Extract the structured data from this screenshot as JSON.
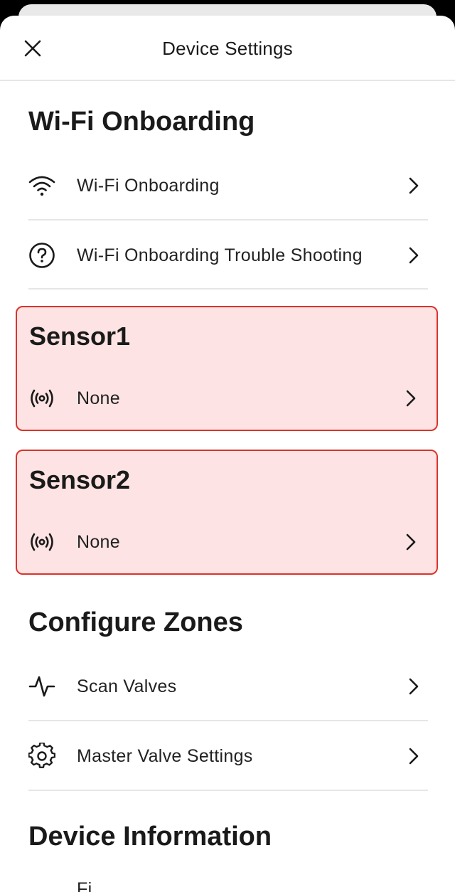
{
  "header": {
    "title": "Device Settings"
  },
  "sections": {
    "wifi": {
      "title": "Wi-Fi Onboarding",
      "items": [
        {
          "label": "Wi-Fi Onboarding",
          "icon": "wifi-icon"
        },
        {
          "label": "Wi-Fi Onboarding Trouble Shooting",
          "icon": "help-circle-icon"
        }
      ]
    },
    "sensor1": {
      "title": "Sensor1",
      "value": "None",
      "icon": "sensor-broadcast-icon",
      "highlight_color": "#fde3e3",
      "border_color": "#d9342b"
    },
    "sensor2": {
      "title": "Sensor2",
      "value": "None",
      "icon": "sensor-broadcast-icon",
      "highlight_color": "#fde3e3",
      "border_color": "#d9342b"
    },
    "zones": {
      "title": "Configure Zones",
      "items": [
        {
          "label": "Scan Valves",
          "icon": "pulse-icon"
        },
        {
          "label": "Master Valve Settings",
          "icon": "gear-icon"
        }
      ]
    },
    "device_info": {
      "title": "Device Information",
      "partial_item": "Fi"
    }
  }
}
